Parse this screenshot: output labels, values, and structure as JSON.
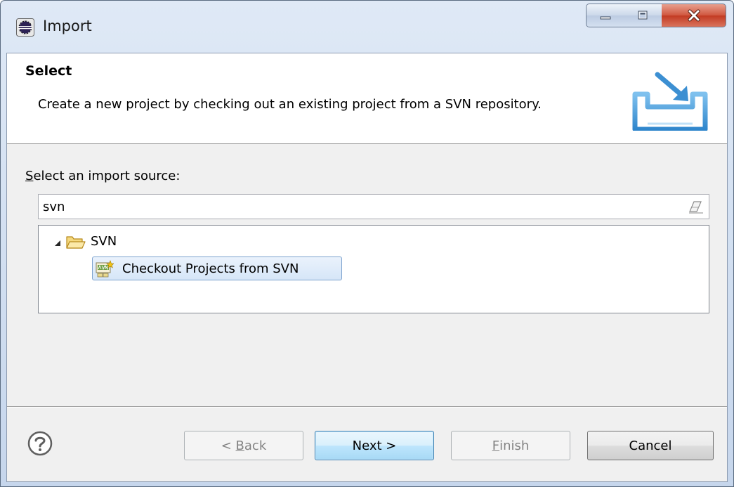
{
  "window": {
    "title": "Import",
    "icon": "eclipse-icon"
  },
  "banner": {
    "title": "Select",
    "description": "Create a new project by checking out an existing project from a SVN repository.",
    "icon": "import-wizard-icon"
  },
  "source": {
    "label_mnemonic": "S",
    "label_rest": "elect an import source:",
    "filter_value": "svn"
  },
  "tree": {
    "group": {
      "label": "SVN",
      "expanded": true,
      "icon": "folder-open-icon"
    },
    "items": [
      {
        "label": "Checkout Projects from SVN",
        "selected": true,
        "icon": "svn-checkout-icon"
      }
    ]
  },
  "buttons": {
    "back_prefix": "< ",
    "back_mnemonic": "B",
    "back_rest": "ack",
    "next": "Next >",
    "finish_mnemonic": "F",
    "finish_rest": "inish",
    "cancel": "Cancel"
  },
  "colors": {
    "selection_border": "#7da2ce",
    "default_button_border": "#3c7fb1",
    "close_button": "#c23a22"
  }
}
